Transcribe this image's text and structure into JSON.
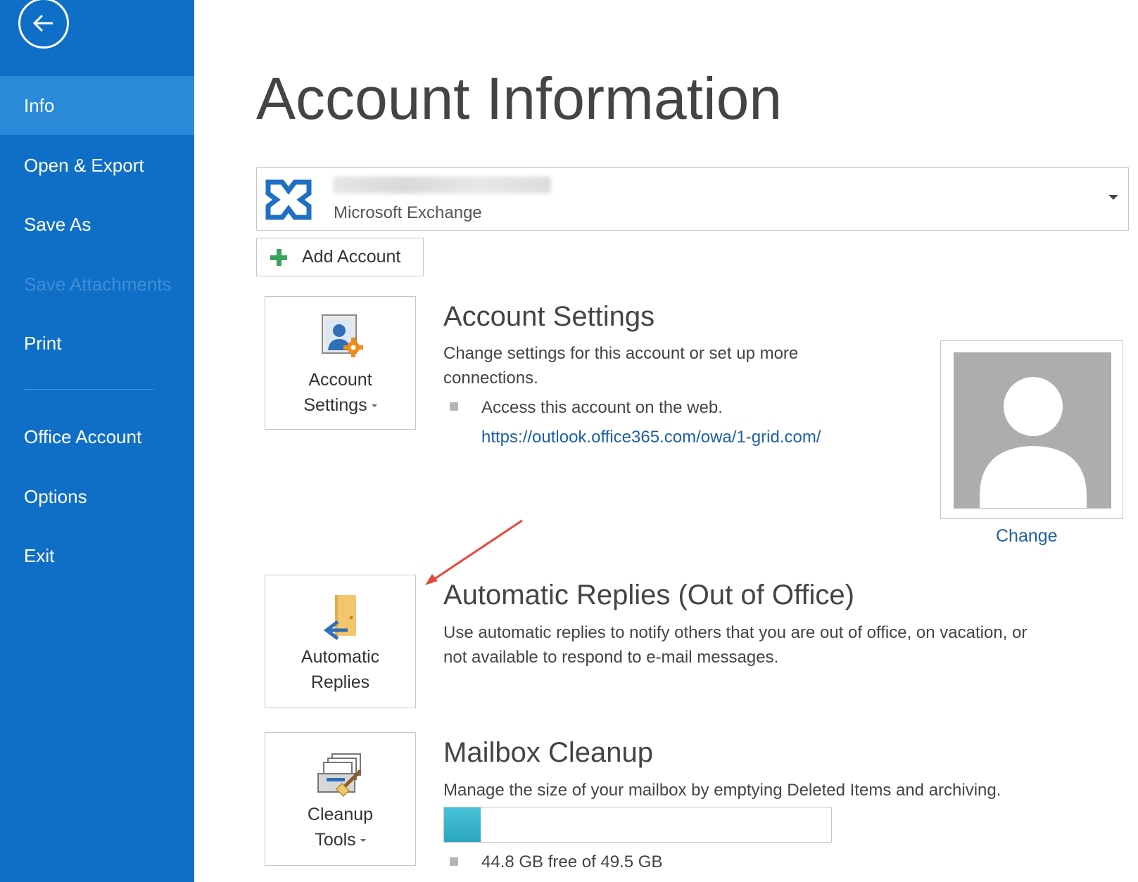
{
  "sidebar": {
    "items": [
      {
        "label": "Info"
      },
      {
        "label": "Open & Export"
      },
      {
        "label": "Save As"
      },
      {
        "label": "Save Attachments"
      },
      {
        "label": "Print"
      },
      {
        "label": "Office Account"
      },
      {
        "label": "Options"
      },
      {
        "label": "Exit"
      }
    ],
    "active": "Info",
    "disabled": "Save Attachments",
    "accent_color": "#0f6fc6"
  },
  "main": {
    "title": "Account Information",
    "account": {
      "type": "Microsoft Exchange"
    },
    "add_account_label": "Add Account",
    "account_settings": {
      "tile_label_line1": "Account",
      "tile_label_line2": "Settings",
      "title": "Account Settings",
      "desc_line1": "Change settings for this account or set up more",
      "desc_line2": "connections.",
      "bullet": "Access this account on the web.",
      "link": "https://outlook.office365.com/owa/1-grid.com/"
    },
    "profile": {
      "change_label": "Change"
    },
    "automatic_replies": {
      "tile_label_line1": "Automatic",
      "tile_label_line2": "Replies",
      "title": "Automatic Replies (Out of Office)",
      "desc_line1": "Use automatic replies to notify others that you are out of office, on vacation, or",
      "desc_line2": "not available to respond to e-mail messages."
    },
    "mailbox_cleanup": {
      "tile_label_line1": "Cleanup",
      "tile_label_line2": "Tools",
      "title": "Mailbox Cleanup",
      "desc": "Manage the size of your mailbox by emptying Deleted Items and archiving.",
      "storage_text": "44.8 GB free of 49.5 GB",
      "used_fraction": 0.095
    }
  }
}
